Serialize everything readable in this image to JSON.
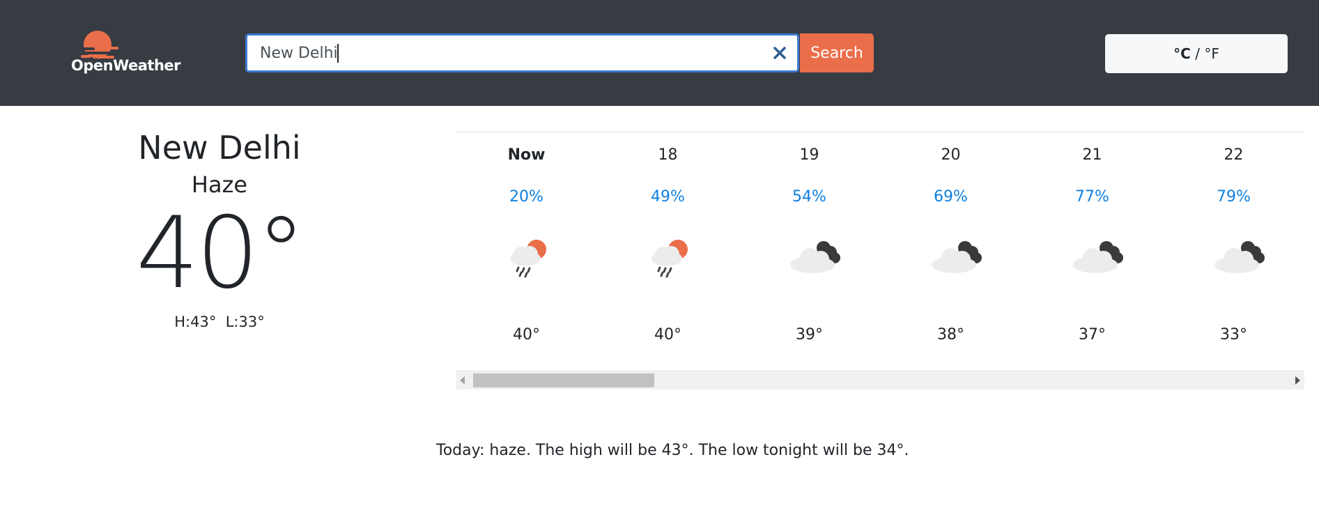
{
  "brand": {
    "name": "OpenWeather",
    "logo_icon": "sun-logo-icon",
    "accent_color": "#eb6e4b"
  },
  "search": {
    "value": "New Delhi",
    "clear_icon": "close-icon",
    "button_label": "Search"
  },
  "units": {
    "celsius": "°C",
    "separator": " / ",
    "fahrenheit": "°F",
    "active": "°C"
  },
  "current": {
    "city": "New Delhi",
    "condition": "Haze",
    "temperature": "40°",
    "high": "H:43°",
    "low": "L:33°"
  },
  "forecast": [
    {
      "time": "Now",
      "pop": "20%",
      "icon": "rain-sun-icon",
      "temp": "40°"
    },
    {
      "time": "18",
      "pop": "49%",
      "icon": "rain-sun-icon",
      "temp": "40°"
    },
    {
      "time": "19",
      "pop": "54%",
      "icon": "cloudy-icon",
      "temp": "39°"
    },
    {
      "time": "20",
      "pop": "69%",
      "icon": "cloudy-icon",
      "temp": "38°"
    },
    {
      "time": "21",
      "pop": "77%",
      "icon": "cloudy-icon",
      "temp": "37°"
    },
    {
      "time": "22",
      "pop": "79%",
      "icon": "cloudy-icon",
      "temp": "33°"
    }
  ],
  "summary": "Today: haze. The high will be 43°. The low tonight will be 34°."
}
